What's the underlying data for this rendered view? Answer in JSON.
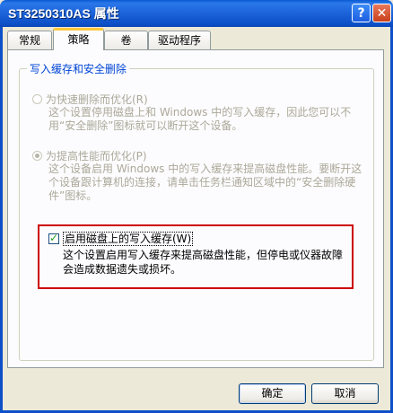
{
  "window": {
    "title": "ST3250310AS 属性",
    "help_glyph": "?",
    "close_glyph": "✕"
  },
  "tabs": [
    {
      "label": "常规",
      "active": false
    },
    {
      "label": "策略",
      "active": true
    },
    {
      "label": "卷",
      "active": false
    },
    {
      "label": "驱动程序",
      "active": false
    }
  ],
  "group": {
    "label": "写入缓存和安全删除"
  },
  "options": {
    "quick_removal": {
      "label": "为快速删除而优化(R)",
      "description": "这个设置停用磁盘上和 Windows 中的写入缓存，因此您可以不用“安全删除”图标就可以断开这个设备。",
      "selected": false
    },
    "performance": {
      "label": "为提高性能而优化(P)",
      "description": "这个设备启用 Windows 中的写入缓存来提高磁盘性能。要断开这个设备跟计算机的连接，请单击任务栏通知区域中的“安全删除硬件”图标。",
      "selected": true
    },
    "enable_write_cache": {
      "label": "启用磁盘上的写入缓存(W)",
      "description": "这个设置启用写入缓存来提高磁盘性能，但停电或仪器故障会造成数据遗失或损坏。",
      "checked": true
    }
  },
  "buttons": {
    "ok": "确定",
    "cancel": "取消"
  },
  "colors": {
    "titlebar": "#0d50c8",
    "highlight_border": "#cc0000",
    "group_label": "#0046d5",
    "disabled_text": "#aca899"
  }
}
